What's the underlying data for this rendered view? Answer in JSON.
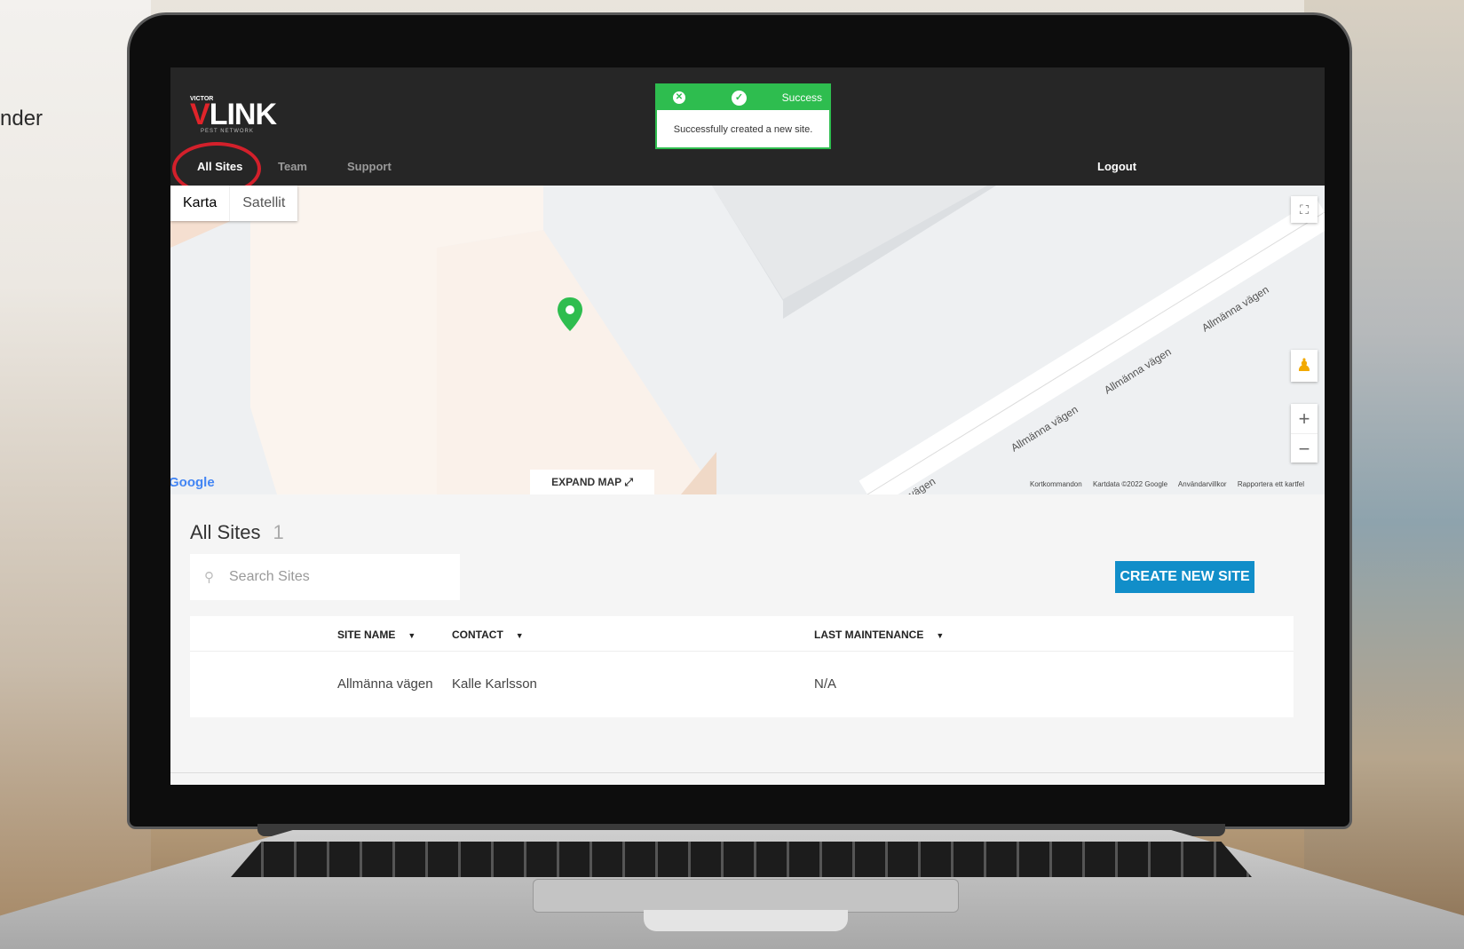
{
  "background": {
    "side_text": "nder"
  },
  "header": {
    "logo": {
      "brand": "VICTOR",
      "name_v": "V",
      "name_rest": "LINK",
      "tagline": "PEST NETWORK"
    },
    "nav": [
      {
        "label": "All Sites"
      },
      {
        "label": "Team"
      },
      {
        "label": "Support"
      }
    ],
    "logout_label": "Logout"
  },
  "toast": {
    "title": "Success",
    "message": "Successfully created a new site.",
    "close_icon": "close-icon",
    "check_icon": "check-icon"
  },
  "map": {
    "tabs": [
      {
        "label": "Karta"
      },
      {
        "label": "Satellit"
      }
    ],
    "expand_label": "EXPAND MAP",
    "google_label": "Google",
    "street_name": "Allmänna vägen",
    "street_label_partial": "nna vägen",
    "credits": [
      "Kortkommandon",
      "Kartdata ©2022 Google",
      "Användarvillkor",
      "Rapportera ett kartfel"
    ],
    "zoom_in": "+",
    "zoom_out": "−"
  },
  "sites": {
    "title": "All Sites",
    "count": "1",
    "search_placeholder": "Search Sites",
    "create_button": "CREATE NEW SITE",
    "columns": [
      "SITE NAME",
      "CONTACT",
      "LAST MAINTENANCE"
    ],
    "rows": [
      {
        "site_name": "Allmänna vägen",
        "contact": "Kalle Karlsson",
        "last_maintenance": "N/A"
      }
    ]
  },
  "colors": {
    "accent": "#118ec9",
    "success": "#2ebd4f",
    "highlight": "#d3202b",
    "brand_red": "#e0242a"
  }
}
